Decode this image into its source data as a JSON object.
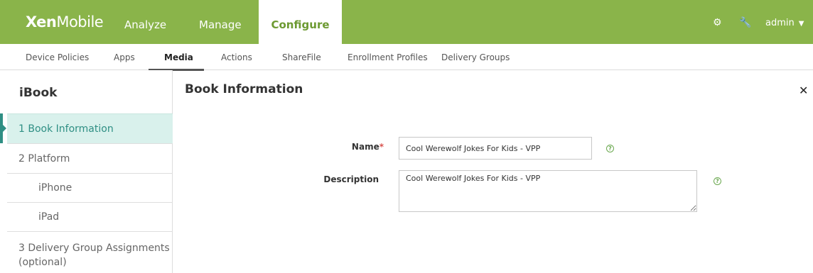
{
  "header": {
    "logo_bold": "Xen",
    "logo_light": "Mobile",
    "nav": [
      "Analyze",
      "Manage",
      "Configure"
    ],
    "user": "admin"
  },
  "subnav": [
    "Device Policies",
    "Apps",
    "Media",
    "Actions",
    "ShareFile",
    "Enrollment Profiles",
    "Delivery Groups"
  ],
  "sidebar": {
    "title": "iBook",
    "items": [
      {
        "label": "1  Book Information"
      },
      {
        "label": "2  Platform"
      },
      {
        "label": "iPhone"
      },
      {
        "label": "iPad"
      },
      {
        "label": "3  Delivery Group Assignments (optional)"
      }
    ]
  },
  "main": {
    "title": "Book Information",
    "name_label": "Name",
    "required_mark": "*",
    "name_value": "Cool Werewolf Jokes For Kids - VPP",
    "description_label": "Description",
    "description_value": "Cool Werewolf Jokes For Kids - VPP"
  },
  "colors": {
    "brand": "#8ab44a",
    "active_step": "#d9f1ec"
  },
  "icons": [
    "gear-icon",
    "wrench-icon",
    "chevron-down-icon",
    "close-icon",
    "help-icon"
  ]
}
